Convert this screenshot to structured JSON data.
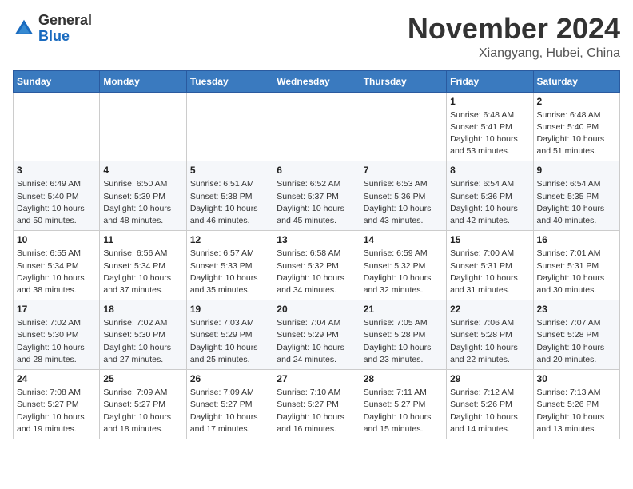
{
  "header": {
    "logo_line1": "General",
    "logo_line2": "Blue",
    "month": "November 2024",
    "location": "Xiangyang, Hubei, China"
  },
  "weekdays": [
    "Sunday",
    "Monday",
    "Tuesday",
    "Wednesday",
    "Thursday",
    "Friday",
    "Saturday"
  ],
  "weeks": [
    [
      {
        "day": "",
        "detail": ""
      },
      {
        "day": "",
        "detail": ""
      },
      {
        "day": "",
        "detail": ""
      },
      {
        "day": "",
        "detail": ""
      },
      {
        "day": "",
        "detail": ""
      },
      {
        "day": "1",
        "detail": "Sunrise: 6:48 AM\nSunset: 5:41 PM\nDaylight: 10 hours\nand 53 minutes."
      },
      {
        "day": "2",
        "detail": "Sunrise: 6:48 AM\nSunset: 5:40 PM\nDaylight: 10 hours\nand 51 minutes."
      }
    ],
    [
      {
        "day": "3",
        "detail": "Sunrise: 6:49 AM\nSunset: 5:40 PM\nDaylight: 10 hours\nand 50 minutes."
      },
      {
        "day": "4",
        "detail": "Sunrise: 6:50 AM\nSunset: 5:39 PM\nDaylight: 10 hours\nand 48 minutes."
      },
      {
        "day": "5",
        "detail": "Sunrise: 6:51 AM\nSunset: 5:38 PM\nDaylight: 10 hours\nand 46 minutes."
      },
      {
        "day": "6",
        "detail": "Sunrise: 6:52 AM\nSunset: 5:37 PM\nDaylight: 10 hours\nand 45 minutes."
      },
      {
        "day": "7",
        "detail": "Sunrise: 6:53 AM\nSunset: 5:36 PM\nDaylight: 10 hours\nand 43 minutes."
      },
      {
        "day": "8",
        "detail": "Sunrise: 6:54 AM\nSunset: 5:36 PM\nDaylight: 10 hours\nand 42 minutes."
      },
      {
        "day": "9",
        "detail": "Sunrise: 6:54 AM\nSunset: 5:35 PM\nDaylight: 10 hours\nand 40 minutes."
      }
    ],
    [
      {
        "day": "10",
        "detail": "Sunrise: 6:55 AM\nSunset: 5:34 PM\nDaylight: 10 hours\nand 38 minutes."
      },
      {
        "day": "11",
        "detail": "Sunrise: 6:56 AM\nSunset: 5:34 PM\nDaylight: 10 hours\nand 37 minutes."
      },
      {
        "day": "12",
        "detail": "Sunrise: 6:57 AM\nSunset: 5:33 PM\nDaylight: 10 hours\nand 35 minutes."
      },
      {
        "day": "13",
        "detail": "Sunrise: 6:58 AM\nSunset: 5:32 PM\nDaylight: 10 hours\nand 34 minutes."
      },
      {
        "day": "14",
        "detail": "Sunrise: 6:59 AM\nSunset: 5:32 PM\nDaylight: 10 hours\nand 32 minutes."
      },
      {
        "day": "15",
        "detail": "Sunrise: 7:00 AM\nSunset: 5:31 PM\nDaylight: 10 hours\nand 31 minutes."
      },
      {
        "day": "16",
        "detail": "Sunrise: 7:01 AM\nSunset: 5:31 PM\nDaylight: 10 hours\nand 30 minutes."
      }
    ],
    [
      {
        "day": "17",
        "detail": "Sunrise: 7:02 AM\nSunset: 5:30 PM\nDaylight: 10 hours\nand 28 minutes."
      },
      {
        "day": "18",
        "detail": "Sunrise: 7:02 AM\nSunset: 5:30 PM\nDaylight: 10 hours\nand 27 minutes."
      },
      {
        "day": "19",
        "detail": "Sunrise: 7:03 AM\nSunset: 5:29 PM\nDaylight: 10 hours\nand 25 minutes."
      },
      {
        "day": "20",
        "detail": "Sunrise: 7:04 AM\nSunset: 5:29 PM\nDaylight: 10 hours\nand 24 minutes."
      },
      {
        "day": "21",
        "detail": "Sunrise: 7:05 AM\nSunset: 5:28 PM\nDaylight: 10 hours\nand 23 minutes."
      },
      {
        "day": "22",
        "detail": "Sunrise: 7:06 AM\nSunset: 5:28 PM\nDaylight: 10 hours\nand 22 minutes."
      },
      {
        "day": "23",
        "detail": "Sunrise: 7:07 AM\nSunset: 5:28 PM\nDaylight: 10 hours\nand 20 minutes."
      }
    ],
    [
      {
        "day": "24",
        "detail": "Sunrise: 7:08 AM\nSunset: 5:27 PM\nDaylight: 10 hours\nand 19 minutes."
      },
      {
        "day": "25",
        "detail": "Sunrise: 7:09 AM\nSunset: 5:27 PM\nDaylight: 10 hours\nand 18 minutes."
      },
      {
        "day": "26",
        "detail": "Sunrise: 7:09 AM\nSunset: 5:27 PM\nDaylight: 10 hours\nand 17 minutes."
      },
      {
        "day": "27",
        "detail": "Sunrise: 7:10 AM\nSunset: 5:27 PM\nDaylight: 10 hours\nand 16 minutes."
      },
      {
        "day": "28",
        "detail": "Sunrise: 7:11 AM\nSunset: 5:27 PM\nDaylight: 10 hours\nand 15 minutes."
      },
      {
        "day": "29",
        "detail": "Sunrise: 7:12 AM\nSunset: 5:26 PM\nDaylight: 10 hours\nand 14 minutes."
      },
      {
        "day": "30",
        "detail": "Sunrise: 7:13 AM\nSunset: 5:26 PM\nDaylight: 10 hours\nand 13 minutes."
      }
    ]
  ]
}
